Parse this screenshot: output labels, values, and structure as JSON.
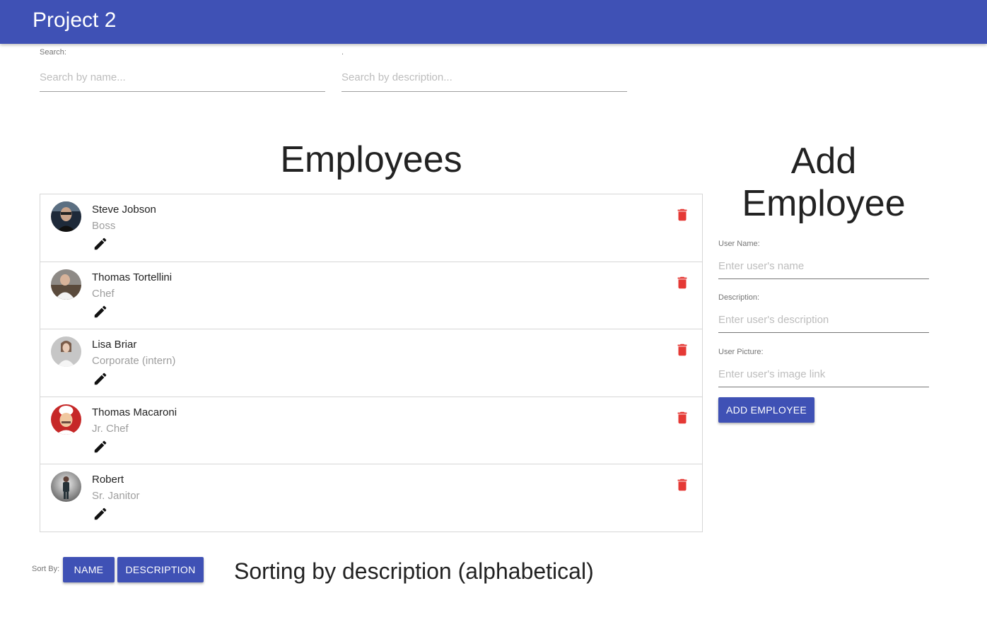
{
  "app": {
    "title": "Project 2",
    "brand_color": "#3f51b5"
  },
  "search": {
    "name_label": "Search:",
    "name_placeholder": "Search by name...",
    "description_label": ".",
    "description_placeholder": "Search by description..."
  },
  "employees": {
    "heading": "Employees",
    "list": [
      {
        "name": "Steve Jobson",
        "description": "Boss",
        "avatar": "photo-man-glasses"
      },
      {
        "name": "Thomas Tortellini",
        "description": "Chef",
        "avatar": "photo-chef"
      },
      {
        "name": "Lisa Briar",
        "description": "Corporate (intern)",
        "avatar": "photo-woman"
      },
      {
        "name": "Thomas Macaroni",
        "description": "Jr. Chef",
        "avatar": "photo-cartoon-chef"
      },
      {
        "name": "Robert",
        "description": "Sr. Janitor",
        "avatar": "photo-man-standing"
      }
    ],
    "edit_icon": "pencil-icon",
    "delete_icon": "trash-icon",
    "delete_color": "#e53935"
  },
  "add_employee": {
    "heading": "Add Employee",
    "name_label": "User Name:",
    "name_placeholder": "Enter user's name",
    "description_label": "Description:",
    "description_placeholder": "Enter user's description",
    "picture_label": "User Picture:",
    "picture_placeholder": "Enter user's image link",
    "submit_label": "ADD EMPLOYEE"
  },
  "sort": {
    "label": "Sort By:",
    "name_button": "NAME",
    "description_button": "DESCRIPTION",
    "status": "Sorting by description (alphabetical)"
  }
}
